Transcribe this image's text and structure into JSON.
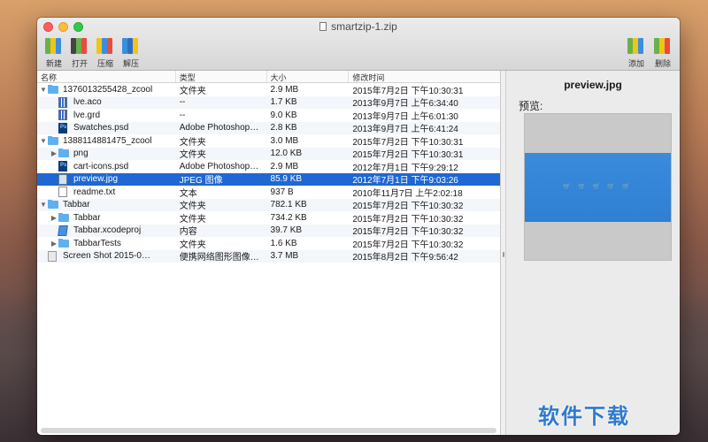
{
  "window": {
    "title": "smartzip-1.zip"
  },
  "toolbar": {
    "new_label": "新建",
    "open_label": "打开",
    "compress_label": "压缩",
    "extract_label": "解压",
    "add_label": "添加",
    "delete_label": "删除"
  },
  "table": {
    "headers": {
      "name": "名称",
      "type": "类型",
      "size": "大小",
      "date": "修改时间"
    },
    "rows": [
      {
        "indent": 0,
        "tri": "▼",
        "icon": "folder",
        "name": "1376013255428_zcool",
        "type": "文件夹",
        "size": "2.9 MB",
        "date": "2015年7月2日 下午10:30:31"
      },
      {
        "indent": 1,
        "tri": "",
        "icon": "grid",
        "name": "lve.aco",
        "type": "--",
        "size": "1.7 KB",
        "date": "2013年9月7日 上午6:34:40"
      },
      {
        "indent": 1,
        "tri": "",
        "icon": "grid",
        "name": "lve.grd",
        "type": "--",
        "size": "9.0 KB",
        "date": "2013年9月7日 上午6:01:30"
      },
      {
        "indent": 1,
        "tri": "",
        "icon": "ps",
        "name": "Swatches.psd",
        "type": "Adobe Photoshop…",
        "size": "2.8 KB",
        "date": "2013年9月7日 上午6:41:24"
      },
      {
        "indent": 0,
        "tri": "▼",
        "icon": "folder",
        "name": "1388114881475_zcool",
        "type": "文件夹",
        "size": "3.0 MB",
        "date": "2015年7月2日 下午10:30:31"
      },
      {
        "indent": 1,
        "tri": "▶",
        "icon": "folder",
        "name": "png",
        "type": "文件夹",
        "size": "12.0 KB",
        "date": "2015年7月2日 下午10:30:31"
      },
      {
        "indent": 1,
        "tri": "",
        "icon": "ps",
        "name": "cart-icons.psd",
        "type": "Adobe Photoshop…",
        "size": "2.9 MB",
        "date": "2012年7月1日 下午9:29:12"
      },
      {
        "indent": 1,
        "tri": "",
        "icon": "img",
        "name": "preview.jpg",
        "type": "JPEG 图像",
        "size": "85.9 KB",
        "date": "2012年7月1日 下午9:03:26",
        "selected": true
      },
      {
        "indent": 1,
        "tri": "",
        "icon": "txt",
        "name": "readme.txt",
        "type": "文本",
        "size": "937 B",
        "date": "2010年11月7日 上午2:02:18"
      },
      {
        "indent": 0,
        "tri": "▼",
        "icon": "folder",
        "name": "Tabbar",
        "type": "文件夹",
        "size": "782.1 KB",
        "date": "2015年7月2日 下午10:30:32"
      },
      {
        "indent": 1,
        "tri": "▶",
        "icon": "folder",
        "name": "Tabbar",
        "type": "文件夹",
        "size": "734.2 KB",
        "date": "2015年7月2日 下午10:30:32"
      },
      {
        "indent": 1,
        "tri": "",
        "icon": "proj",
        "name": "Tabbar.xcodeproj",
        "type": "内容",
        "size": "39.7 KB",
        "date": "2015年7月2日 下午10:30:32"
      },
      {
        "indent": 1,
        "tri": "▶",
        "icon": "folder",
        "name": "TabbarTests",
        "type": "文件夹",
        "size": "1.6 KB",
        "date": "2015年7月2日 下午10:30:32"
      },
      {
        "indent": 0,
        "tri": "",
        "icon": "shot",
        "name": "Screen Shot 2015-0…",
        "type": "便携网络图形图像…",
        "size": "3.7 MB",
        "date": "2015年8月2日 下午9:56:42"
      }
    ]
  },
  "preview": {
    "filename": "preview.jpg",
    "label": "预览:",
    "image_text": "🛒 🛒 🛒 🛒 🛒"
  },
  "watermark": {
    "text": "软件下载"
  },
  "colors": {
    "selection": "#1f67d2",
    "folder": "#5fb0f1",
    "accent": "#2e7ad1"
  }
}
